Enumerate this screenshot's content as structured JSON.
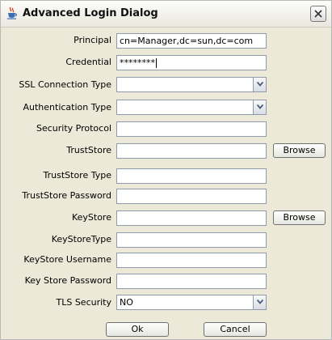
{
  "window": {
    "title": "Advanced Login Dialog",
    "icon": "java-cup-icon"
  },
  "fields": {
    "principal": {
      "label": "Principal",
      "value": "cn=Manager,dc=sun,dc=com"
    },
    "credential": {
      "label": "Credential",
      "value": "********"
    },
    "ssl_connection_type": {
      "label": "SSL Connection Type",
      "value": ""
    },
    "authentication_type": {
      "label": "Authentication Type",
      "value": ""
    },
    "security_protocol": {
      "label": "Security Protocol",
      "value": ""
    },
    "truststore": {
      "label": "TrustStore",
      "value": ""
    },
    "truststore_type": {
      "label": "TrustStore Type",
      "value": ""
    },
    "truststore_password": {
      "label": "TrustStore Password",
      "value": ""
    },
    "keystore": {
      "label": "KeyStore",
      "value": ""
    },
    "keystore_type": {
      "label": "KeyStoreType",
      "value": ""
    },
    "keystore_username": {
      "label": "KeyStore Username",
      "value": ""
    },
    "key_store_password": {
      "label": "Key Store Password",
      "value": ""
    },
    "tls_security": {
      "label": "TLS Security",
      "value": "NO"
    }
  },
  "buttons": {
    "browse_truststore": "Browse",
    "browse_keystore": "Browse",
    "ok": "Ok",
    "cancel": "Cancel"
  },
  "colors": {
    "dialog_background": "#ece9d8",
    "field_border": "#8f9bad"
  }
}
